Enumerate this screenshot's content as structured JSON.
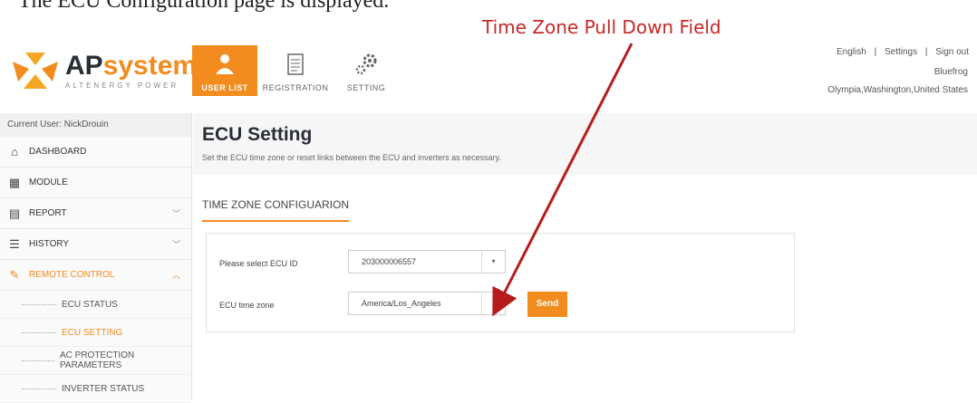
{
  "doc_caption": "The ECU Configuration page is displayed.",
  "annotation": {
    "text": "Time Zone Pull Down Field",
    "color": "#c62828"
  },
  "brand": {
    "ap": "AP",
    "sys": "systems",
    "tagline": "ALTENERGY POWER",
    "accent": "#f28c1e"
  },
  "nav": [
    {
      "label": "USER LIST",
      "icon": "users-icon",
      "active": true
    },
    {
      "label": "REGISTRATION",
      "icon": "document-icon",
      "active": false
    },
    {
      "label": "SETTING",
      "icon": "gears-icon",
      "active": false
    }
  ],
  "top_links": {
    "language": "English",
    "settings": "Settings",
    "signout": "Sign out",
    "sep": "|"
  },
  "user": {
    "name": "Bluefrog",
    "location": "Olympia,Washington,United States"
  },
  "sidebar": {
    "current_user": "Current User: NickDrouin",
    "items": [
      {
        "label": "DASHBOARD",
        "icon": "home-icon"
      },
      {
        "label": "MODULE",
        "icon": "grid-icon"
      },
      {
        "label": "REPORT",
        "icon": "report-icon",
        "chevron": "chevron-down-icon"
      },
      {
        "label": "HISTORY",
        "icon": "database-icon",
        "chevron": "chevron-down-icon"
      },
      {
        "label": "REMOTE CONTROL",
        "icon": "wrench-icon",
        "chevron": "chevron-down-icon",
        "active": true
      }
    ],
    "sub_items": [
      {
        "label": "ECU STATUS"
      },
      {
        "label": "ECU SETTING",
        "active": true
      },
      {
        "label": "AC PROTECTION PARAMETERS"
      },
      {
        "label": "INVERTER STATUS"
      }
    ]
  },
  "main": {
    "title": "ECU Setting",
    "subtitle": "Set the ECU time zone or reset links between the ECU and inverters as necessary.",
    "section_title": "TIME ZONE CONFIGUARION",
    "ecu_id_label": "Please select ECU ID",
    "ecu_id_value": "203000006557",
    "time_zone_label": "ECU time zone",
    "time_zone_value": "America/Los_Angeles",
    "send_label": "Send",
    "dropdown_arrow": "▾"
  }
}
